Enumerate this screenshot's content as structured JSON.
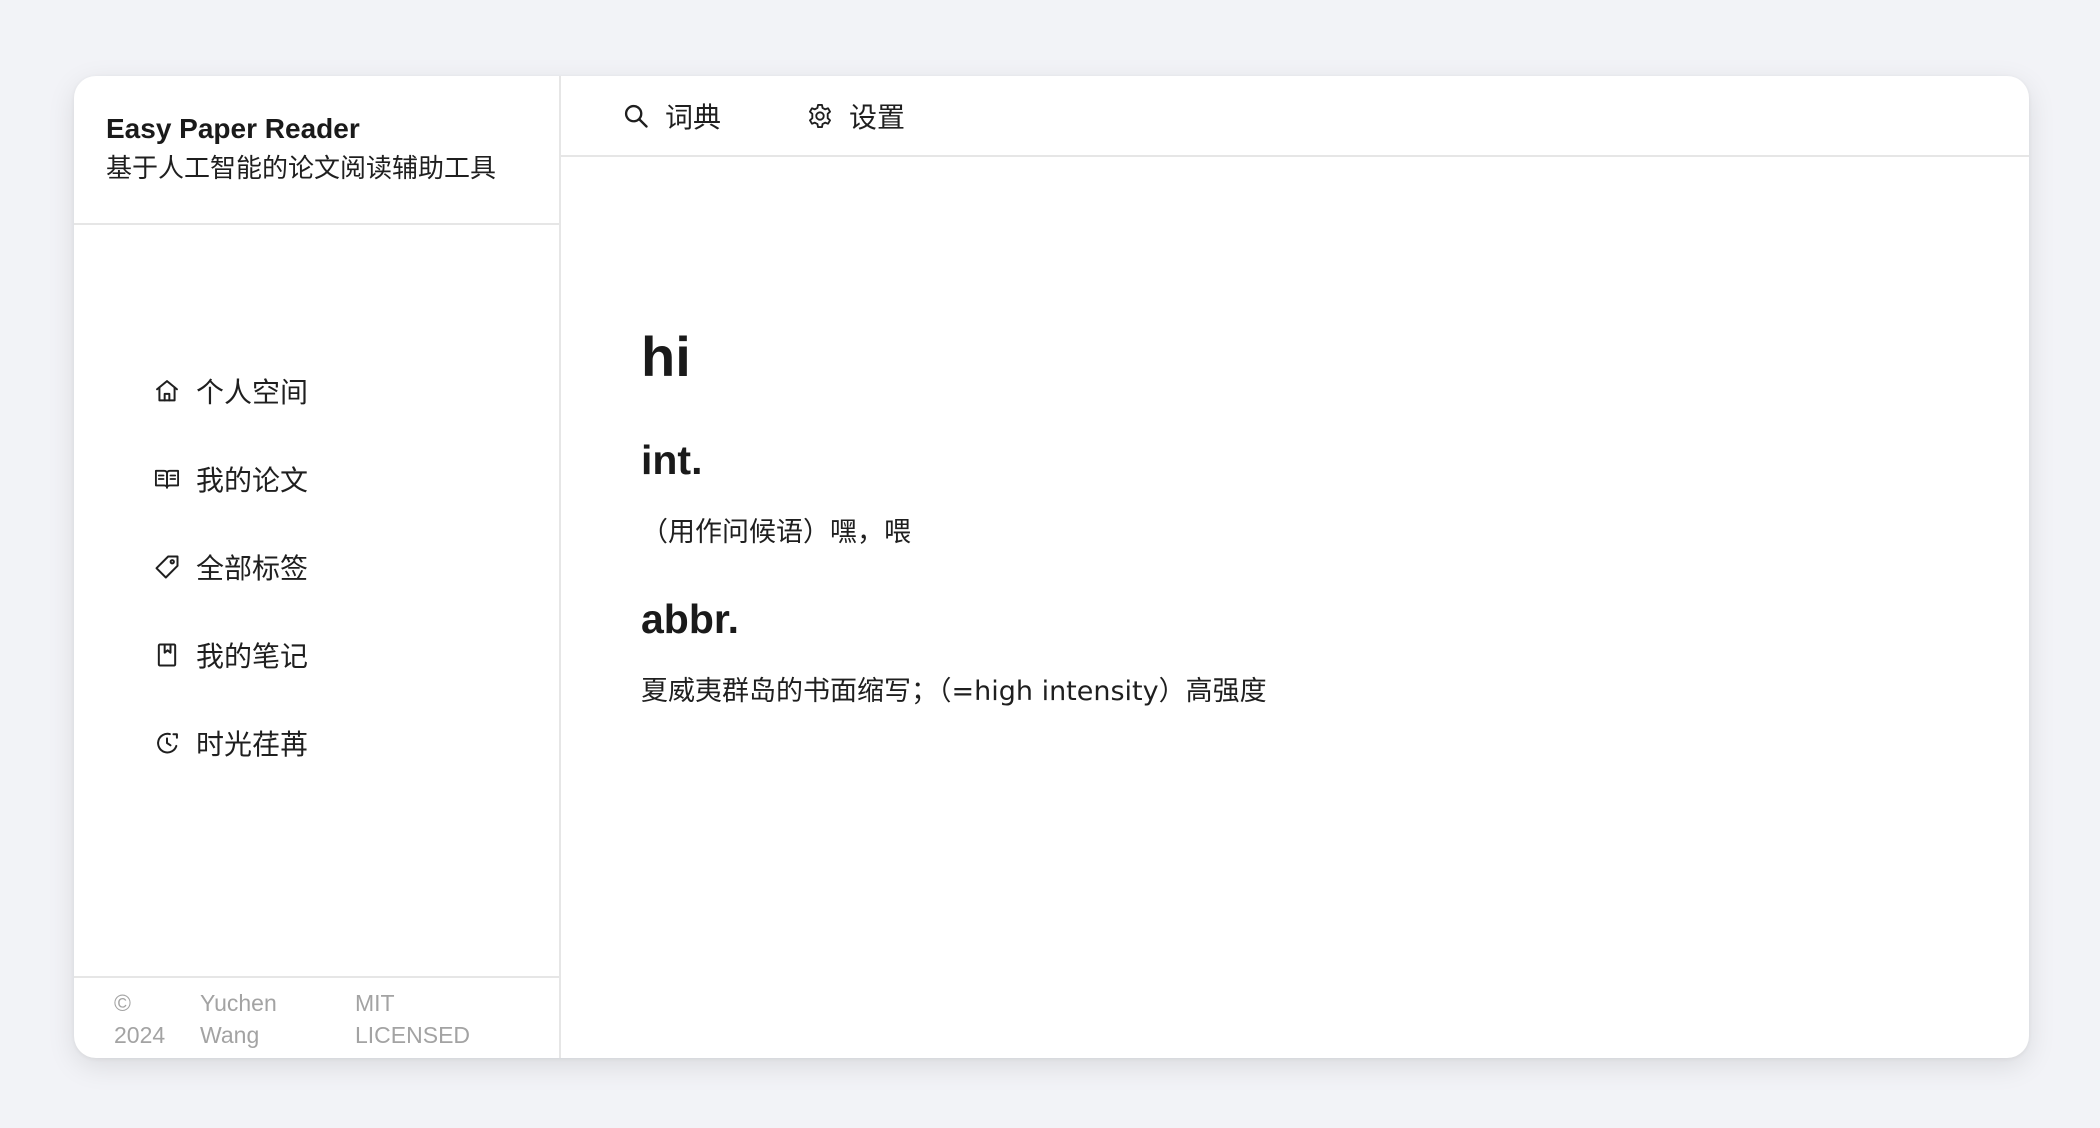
{
  "app": {
    "title": "Easy Paper Reader",
    "subtitle": "基于人工智能的论文阅读辅助工具"
  },
  "sidebar": {
    "items": [
      {
        "label": "个人空间",
        "icon": "home-icon"
      },
      {
        "label": "我的论文",
        "icon": "book-open-icon"
      },
      {
        "label": "全部标签",
        "icon": "tag-icon"
      },
      {
        "label": "我的笔记",
        "icon": "bookmark-icon"
      },
      {
        "label": "时光荏苒",
        "icon": "history-icon"
      }
    ]
  },
  "footer": {
    "copyright": "© 2024",
    "author": "Yuchen Wang",
    "license": "MIT LICENSED"
  },
  "topbar": {
    "tabs": [
      {
        "label": "词典",
        "icon": "search-icon"
      },
      {
        "label": "设置",
        "icon": "gear-icon"
      }
    ]
  },
  "dictionary": {
    "word": "hi",
    "entries": [
      {
        "pos": "int.",
        "definition": "（用作问候语）嘿，喂"
      },
      {
        "pos": "abbr.",
        "definition": "夏威夷群岛的书面缩写；（=high intensity）高强度"
      }
    ]
  },
  "colors": {
    "background": "#f2f3f7",
    "panel": "#ffffff",
    "divider": "#e6e6e6",
    "text": "#1f1f1f",
    "muted": "#a3a3a3"
  }
}
